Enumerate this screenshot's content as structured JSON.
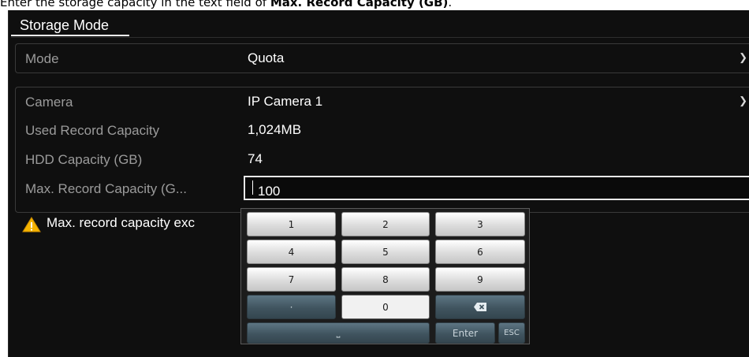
{
  "caption": {
    "prefix": "Enter the storage capacity in the text field of ",
    "bold": "Max. Record Capacity (GB)",
    "suffix": "."
  },
  "panel": {
    "title": "Storage Mode"
  },
  "mode": {
    "label": "Mode",
    "value": "Quota"
  },
  "camera": {
    "label": "Camera",
    "value": "IP Camera 1"
  },
  "used_capacity": {
    "label": "Used Record Capacity",
    "value": "1,024MB"
  },
  "hdd_capacity": {
    "label": "HDD Capacity (GB)",
    "value": "74"
  },
  "max_capacity": {
    "label": "Max. Record Capacity (G...",
    "value": "100"
  },
  "warning": {
    "icon": "warning-icon",
    "text": "Max. record capacity exc"
  },
  "keypad": {
    "k1": "1",
    "k2": "2",
    "k3": "3",
    "k4": "4",
    "k5": "5",
    "k6": "6",
    "k7": "7",
    "k8": "8",
    "k9": "9",
    "dot": "·",
    "k0": "0",
    "backspace_icon": "backspace-icon",
    "space": "⎵",
    "enter": "Enter",
    "esc": "ESC"
  },
  "colors": {
    "panel_bg": "#0f0f0f",
    "label_gray": "#9b9b9b",
    "key_light": "#dcdcdc",
    "key_dark": "#40545f",
    "warning_yellow": "#f5b400"
  }
}
